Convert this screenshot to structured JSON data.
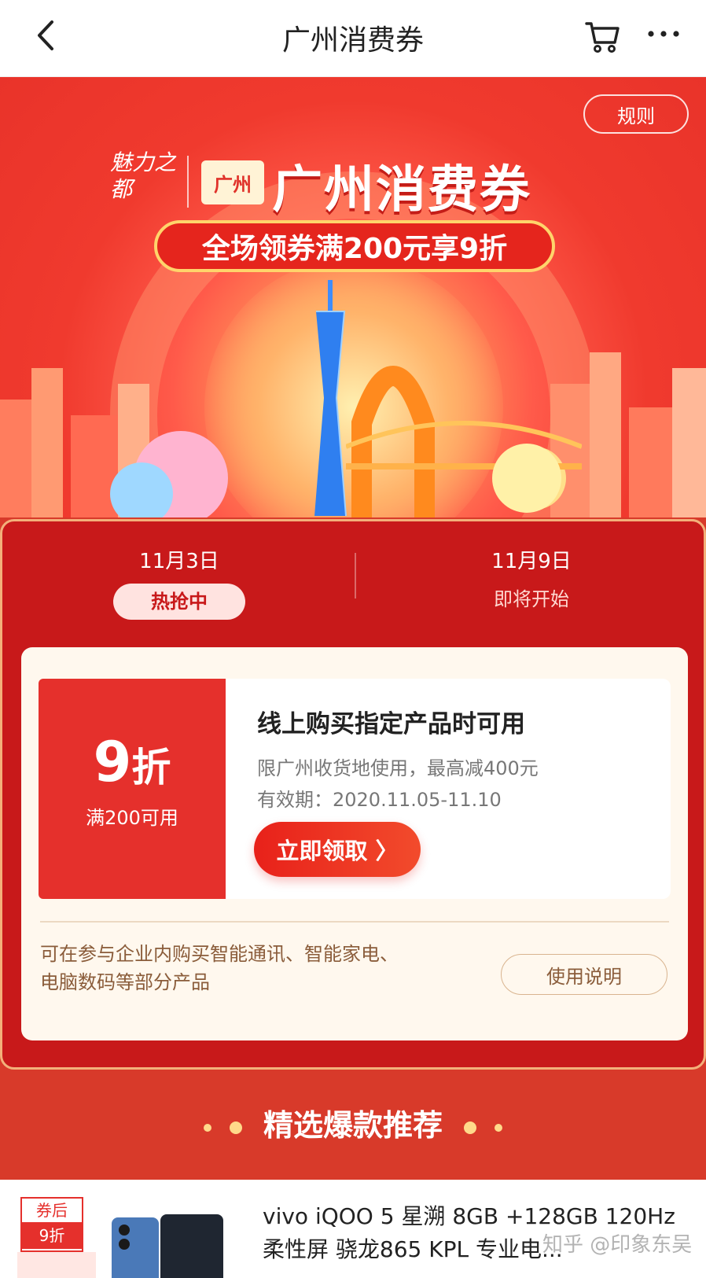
{
  "nav": {
    "title": "广州消费券"
  },
  "banner": {
    "rules_label": "规则",
    "seal_text": "魅力之都",
    "city_tag": "广州",
    "title": "广州消费券",
    "promo": "全场领券满200元享9折"
  },
  "tabs": [
    {
      "date": "11月3日",
      "status": "热抢中"
    },
    {
      "date": "11月9日",
      "status": "即将开始"
    }
  ],
  "coupon": {
    "discount": "9",
    "discount_unit": "折",
    "condition": "满200可用",
    "headline": "线上购买指定产品时可用",
    "restriction": "限广州收货地使用，最高减400元",
    "validity": "有效期：2020.11.05-11.10",
    "claim_label": "立即领取 〉"
  },
  "card_footer": {
    "description": "可在参与企业内购买智能通讯、智能家电、电脑数码等部分产品",
    "howto_label": "使用说明"
  },
  "section": {
    "title": "精选爆款推荐"
  },
  "product": {
    "badge_top": "券后",
    "badge_bottom": "9折",
    "name": "vivo iQOO 5 星溯 8GB +128GB 120Hz柔性屏 骁龙865 KPL 专业电...",
    "watermark": "知乎 @印象东吴"
  },
  "colors": {
    "brand_red": "#e5302c",
    "panel_red": "#c8191a",
    "card_bg": "#fff8ee"
  }
}
